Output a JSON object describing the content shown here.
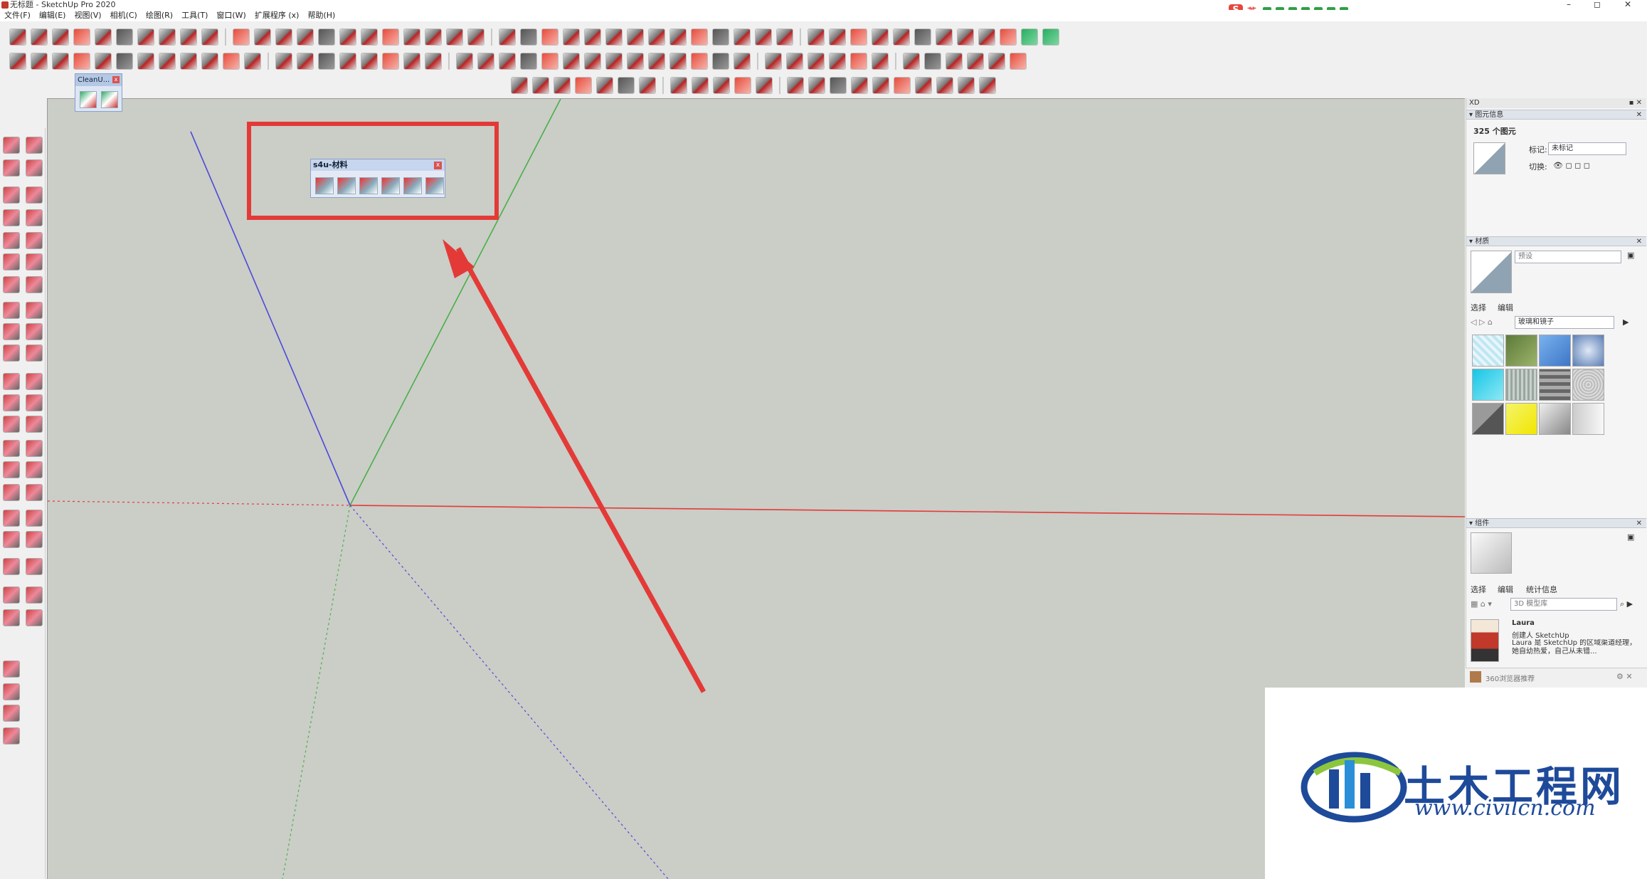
{
  "window": {
    "title": "无标题 - SketchUp Pro 2020",
    "controls": {
      "minimize": "–",
      "maximize": "◻",
      "close": "✕"
    }
  },
  "menu": [
    "文件(F)",
    "编辑(E)",
    "视图(V)",
    "相机(C)",
    "绘图(R)",
    "工具(T)",
    "窗口(W)",
    "扩展程序 (x)",
    "帮助(H)"
  ],
  "ime": {
    "logo": "S",
    "lang": "英"
  },
  "cleanup_toolbar": {
    "title": "CleanU...",
    "close": "x"
  },
  "s4u_toolbar": {
    "title": "s4u-材料",
    "close": "x"
  },
  "tray": {
    "tray_label": "XD",
    "entity_info": {
      "header": "图元信息",
      "count": "325 个图元",
      "tag_label": "标记:",
      "tag_value": "未标记",
      "toggle_label": "切换:"
    },
    "materials": {
      "header": "材质",
      "preset_placeholder": "预设",
      "tabs": [
        "选择",
        "编辑"
      ],
      "library": "玻璃和镜子"
    },
    "components": {
      "header": "组件",
      "tabs": [
        "选择",
        "编辑",
        "统计信息"
      ],
      "search_placeholder": "3D 模型库",
      "item_title": "Laura",
      "item_author": "创建人 SketchUp",
      "item_desc": "Laura 是 SketchUp 的区域渠道经理，她自幼热爱，自己从未错..."
    },
    "bottom": {
      "text": "360浏览器推荐"
    }
  },
  "watermark": {
    "title": "土木工程网",
    "url": "www.civilcn.com"
  },
  "colors": {
    "viewport": "#cbcdc7",
    "axis_red": "#e33a37",
    "axis_green": "#48b048",
    "axis_blue": "#4a4ad8",
    "highlight": "#e33a37",
    "brand_blue": "#1e4a9a"
  }
}
